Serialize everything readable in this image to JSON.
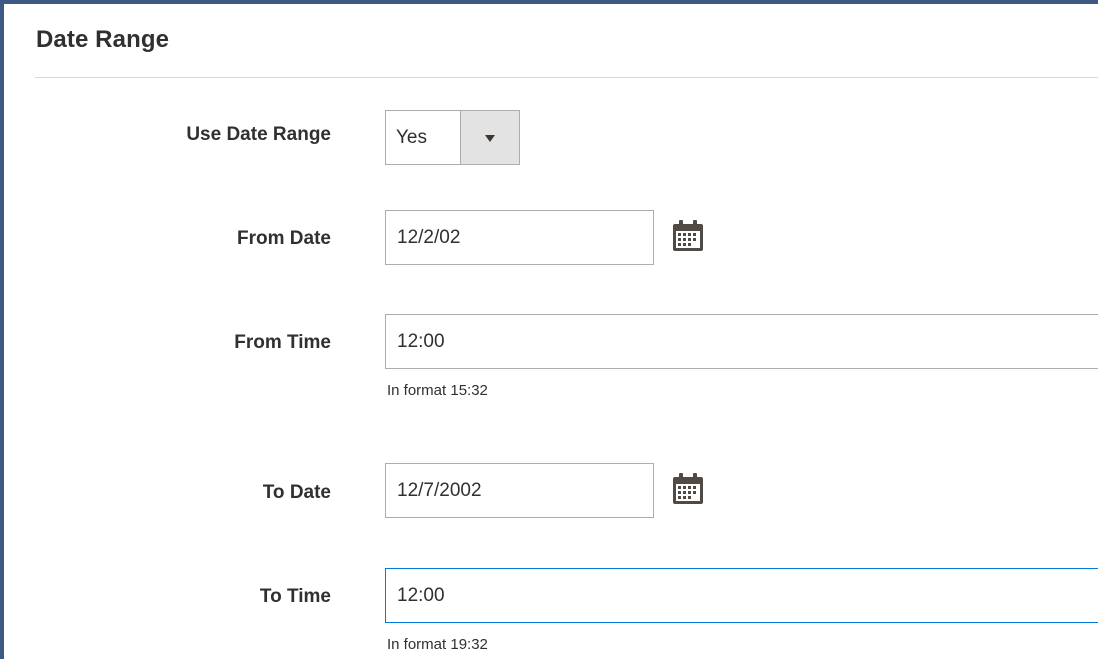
{
  "section": {
    "title": "Date Range"
  },
  "fields": {
    "use_date_range": {
      "label": "Use Date Range",
      "value": "Yes"
    },
    "from_date": {
      "label": "From Date",
      "value": "12/2/02",
      "calendar_icon": "calendar-icon"
    },
    "from_time": {
      "label": "From Time",
      "value": "12:00",
      "note": "In format 15:32"
    },
    "to_date": {
      "label": "To Date",
      "value": "12/7/2002",
      "calendar_icon": "calendar-icon"
    },
    "to_time": {
      "label": "To Time",
      "value": "12:00",
      "note": "In format 19:32"
    }
  },
  "colors": {
    "frame_border": "#3c5a84",
    "input_border": "#adadad",
    "focus_border": "#007bdb",
    "text": "#303030"
  }
}
